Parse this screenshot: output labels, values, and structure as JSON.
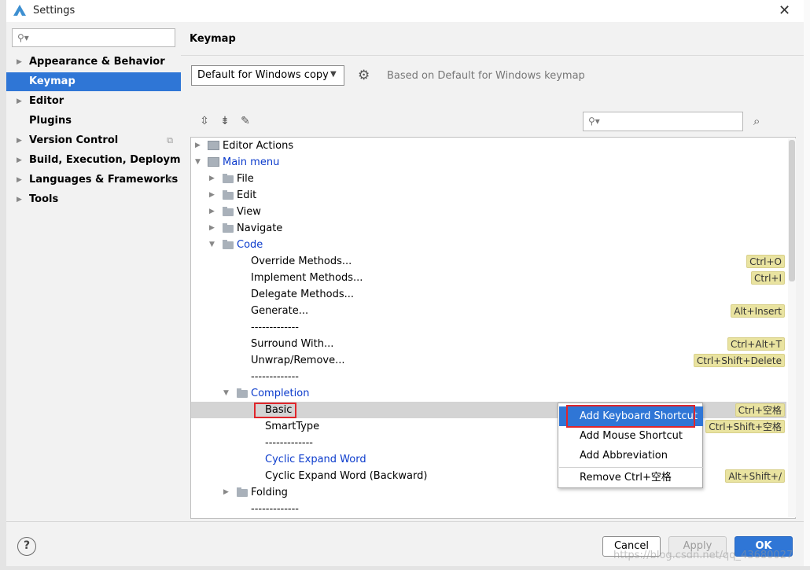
{
  "window": {
    "title": "Settings"
  },
  "sidebar": {
    "search_placeholder": "",
    "items": [
      {
        "label": "Appearance & Behavior",
        "arrow": "▶"
      },
      {
        "label": "Keymap"
      },
      {
        "label": "Editor",
        "arrow": "▶"
      },
      {
        "label": "Plugins"
      },
      {
        "label": "Version Control",
        "arrow": "▶"
      },
      {
        "label": "Build, Execution, Deployment",
        "arrow": "▶"
      },
      {
        "label": "Languages & Frameworks",
        "arrow": "▶"
      },
      {
        "label": "Tools",
        "arrow": "▶"
      }
    ]
  },
  "header": {
    "title": "Keymap"
  },
  "keymap": {
    "scheme_value": "Default for Windows copy",
    "based_on": "Based on Default for Windows keymap",
    "search_placeholder": ""
  },
  "tree": [
    {
      "label": "Editor Actions",
      "arrow": "▶"
    },
    {
      "label": "Main menu",
      "arrow": "▼"
    },
    {
      "label": "File",
      "arrow": "▶"
    },
    {
      "label": "Edit",
      "arrow": "▶"
    },
    {
      "label": "View",
      "arrow": "▶"
    },
    {
      "label": "Navigate",
      "arrow": "▶"
    },
    {
      "label": "Code",
      "arrow": "▼"
    },
    {
      "label": "Override Methods...",
      "shortcut": "Ctrl+O"
    },
    {
      "label": "Implement Methods...",
      "shortcut": "Ctrl+I"
    },
    {
      "label": "Delegate Methods..."
    },
    {
      "label": "Generate...",
      "shortcut": "Alt+Insert"
    },
    {
      "label": "-------------"
    },
    {
      "label": "Surround With...",
      "shortcut": "Ctrl+Alt+T"
    },
    {
      "label": "Unwrap/Remove...",
      "shortcut": "Ctrl+Shift+Delete"
    },
    {
      "label": "-------------"
    },
    {
      "label": "Completion",
      "arrow": "▼"
    },
    {
      "label": "Basic",
      "shortcut": "Ctrl+空格"
    },
    {
      "label": "SmartType",
      "shortcut": "Ctrl+Shift+空格"
    },
    {
      "label": "-------------"
    },
    {
      "label": "Cyclic Expand Word"
    },
    {
      "label": "Cyclic Expand Word (Backward)",
      "shortcut": "Alt+Shift+/"
    },
    {
      "label": "Folding",
      "arrow": "▶"
    },
    {
      "label": "-------------"
    }
  ],
  "context_menu": {
    "items": [
      {
        "label": "Add Keyboard Shortcut"
      },
      {
        "label": "Add Mouse Shortcut"
      },
      {
        "label": "Add Abbreviation"
      },
      {
        "label": "Remove Ctrl+空格"
      }
    ]
  },
  "buttons": {
    "cancel": "Cancel",
    "apply": "Apply",
    "ok": "OK",
    "help": "?"
  },
  "watermark": "https://blog.csdn.net/qq_43680027",
  "colors": {
    "accent": "#2f76d6",
    "shortcut_bg": "#e9e3a0",
    "highlight_box": "#e0262b",
    "link": "#0b3bcc"
  }
}
